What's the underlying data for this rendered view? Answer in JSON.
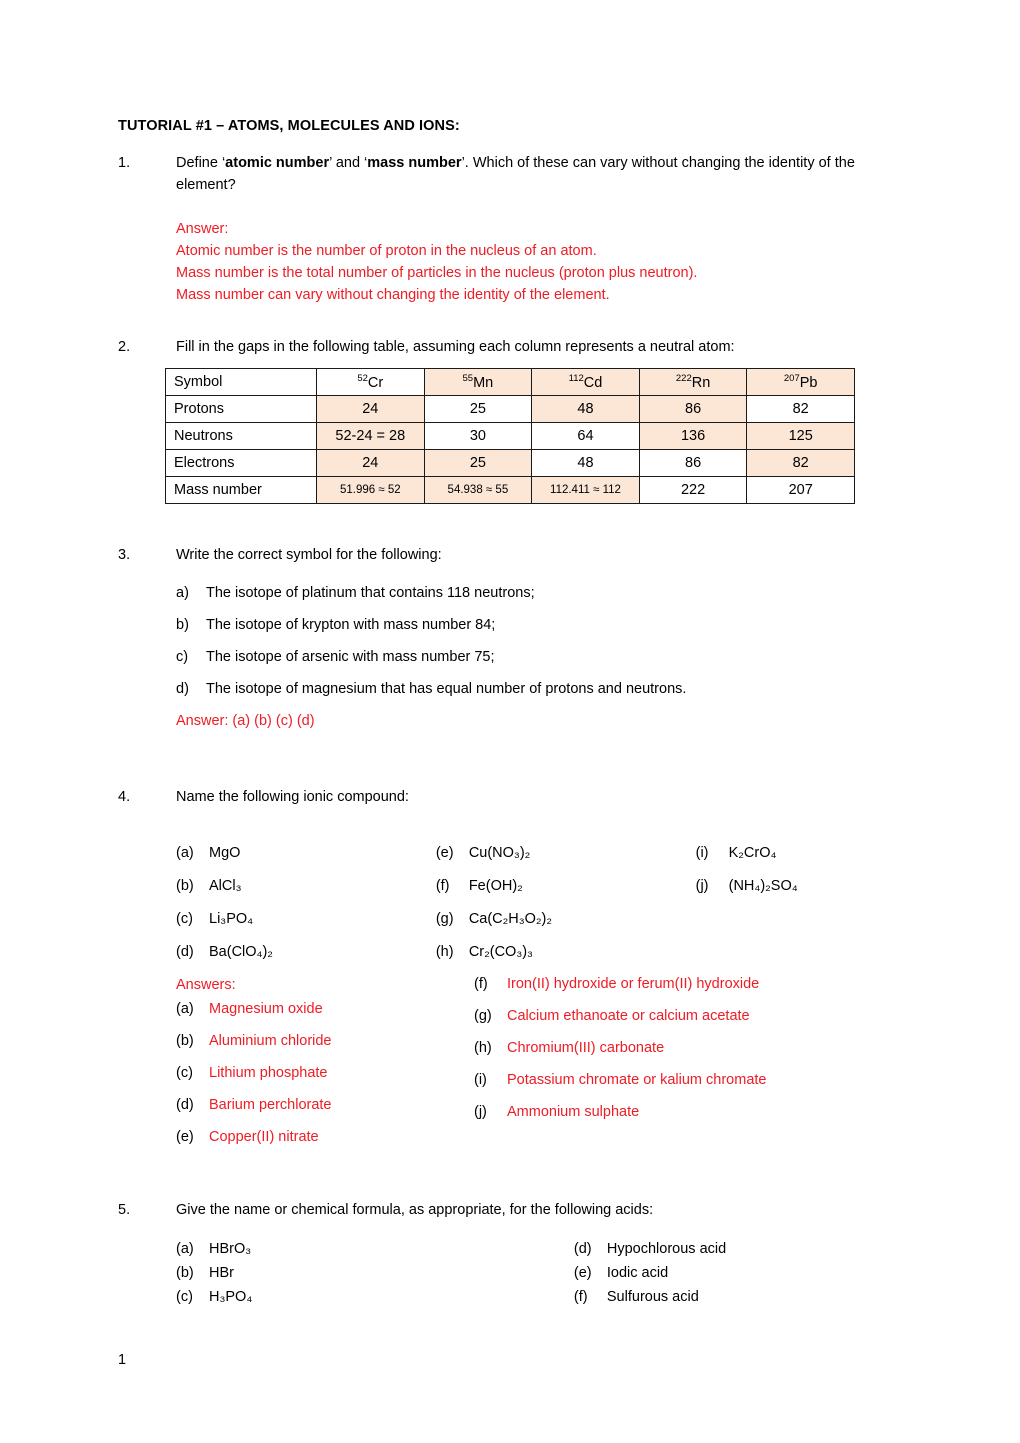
{
  "document": {
    "title": "TUTORIAL #1 – ATOMS, MOLECULES AND IONS:",
    "page_number": "1",
    "answer_color": "#ee1c25",
    "table_shade_color": "#fce6d6"
  },
  "q1": {
    "number": "1.",
    "text_pre": "Define ‘",
    "bold1": "atomic number",
    "text_mid": "’ and ‘",
    "bold2": "mass number",
    "text_post": "’. Which of these can vary without changing the identity of the element?",
    "answer": {
      "heading": "Answer:",
      "line1": "Atomic number is the number of proton in the nucleus of an atom.",
      "line2": "Mass number is the total number of particles in the nucleus (proton plus neutron).",
      "line3": "Mass number can vary without changing the identity of the element."
    }
  },
  "q2": {
    "number": "2.",
    "text": "Fill in the gaps in the following table, assuming each column represents a neutral atom:",
    "table": {
      "row_labels": [
        "Symbol",
        "Protons",
        "Neutrons",
        "Electrons",
        "Mass number"
      ],
      "symbols": [
        {
          "mass": "52",
          "element": "Cr"
        },
        {
          "mass": "55",
          "element": "Mn"
        },
        {
          "mass": "112",
          "element": "Cd"
        },
        {
          "mass": "222",
          "element": "Rn"
        },
        {
          "mass": "207",
          "element": "Pb"
        }
      ],
      "symbol_shade": [
        false,
        true,
        true,
        true,
        true
      ],
      "protons": [
        "24",
        "25",
        "48",
        "86",
        "82"
      ],
      "protons_shade": [
        true,
        false,
        true,
        true,
        false
      ],
      "neutrons": [
        "52-24 = 28",
        "30",
        "64",
        "136",
        "125"
      ],
      "neutrons_shade": [
        true,
        false,
        false,
        true,
        true
      ],
      "electrons": [
        "24",
        "25",
        "48",
        "86",
        "82"
      ],
      "electrons_shade": [
        true,
        true,
        false,
        false,
        true
      ],
      "mass_number": [
        "51.996 ≈ 52",
        "54.938 ≈ 55",
        "112.411 ≈ 112",
        "222",
        "207"
      ],
      "mass_number_shade": [
        true,
        true,
        true,
        false,
        false
      ],
      "mass_number_small": [
        true,
        true,
        true,
        false,
        false
      ]
    }
  },
  "q3": {
    "number": "3.",
    "text": "Write the correct symbol for the following:",
    "items": [
      {
        "marker": "a)",
        "text": "The isotope of platinum that contains 118 neutrons;"
      },
      {
        "marker": "b)",
        "text": "The isotope of krypton with mass number 84;"
      },
      {
        "marker": "c)",
        "text": "The isotope of arsenic with mass number 75;"
      },
      {
        "marker": "d)",
        "text": "The isotope of magnesium that has equal number of protons and neutrons."
      }
    ],
    "answer_line": "Answer: (a)        (b)        (c)        (d)"
  },
  "q4": {
    "number": "4.",
    "text": "Name the following ionic compound:",
    "formulas_col1": [
      {
        "marker": "(a)",
        "formula": "MgO"
      },
      {
        "marker": "(b)",
        "formula": "AlCl₃"
      },
      {
        "marker": "(c)",
        "formula": "Li₃PO₄"
      },
      {
        "marker": "(d)",
        "formula": "Ba(ClO₄)₂"
      }
    ],
    "formulas_col2": [
      {
        "marker": "(e)",
        "formula": "Cu(NO₃)₂"
      },
      {
        "marker": "(f)",
        "formula": "Fe(OH)₂"
      },
      {
        "marker": "(g)",
        "formula": "Ca(C₂H₃O₂)₂"
      },
      {
        "marker": "(h)",
        "formula": "Cr₂(CO₃)₃"
      }
    ],
    "formulas_col3": [
      {
        "marker": "(i)",
        "formula": "K₂CrO₄"
      },
      {
        "marker": "(j)",
        "formula": "(NH₄)₂SO₄"
      }
    ],
    "answers_heading": "Answers:",
    "answers_col1": [
      {
        "marker": "(a)",
        "name": "Magnesium oxide"
      },
      {
        "marker": "(b)",
        "name": "Aluminium chloride"
      },
      {
        "marker": "(c)",
        "name": "Lithium phosphate"
      },
      {
        "marker": "(d)",
        "name": "Barium perchlorate"
      },
      {
        "marker": "(e)",
        "name": "Copper(II) nitrate"
      }
    ],
    "answers_col2": [
      {
        "marker": "(f)",
        "name": "Iron(II) hydroxide or ferum(II) hydroxide"
      },
      {
        "marker": "(g)",
        "name": "Calcium ethanoate or calcium acetate"
      },
      {
        "marker": "(h)",
        "name": "Chromium(III) carbonate"
      },
      {
        "marker": "(i)",
        "name": "Potassium chromate or kalium chromate"
      },
      {
        "marker": "(j)",
        "name": "Ammonium sulphate"
      }
    ]
  },
  "q5": {
    "number": "5.",
    "text": "Give the name or chemical formula, as appropriate, for the following acids:",
    "col1": [
      {
        "marker": "(a)",
        "text": "HBrO₃"
      },
      {
        "marker": "(b)",
        "text": "HBr"
      },
      {
        "marker": "(c)",
        "text": "H₃PO₄"
      }
    ],
    "col2": [
      {
        "marker": "(d)",
        "text": "Hypochlorous acid"
      },
      {
        "marker": "(e)",
        "text": "Iodic acid"
      },
      {
        "marker": "(f)",
        "text": "Sulfurous acid"
      }
    ]
  }
}
